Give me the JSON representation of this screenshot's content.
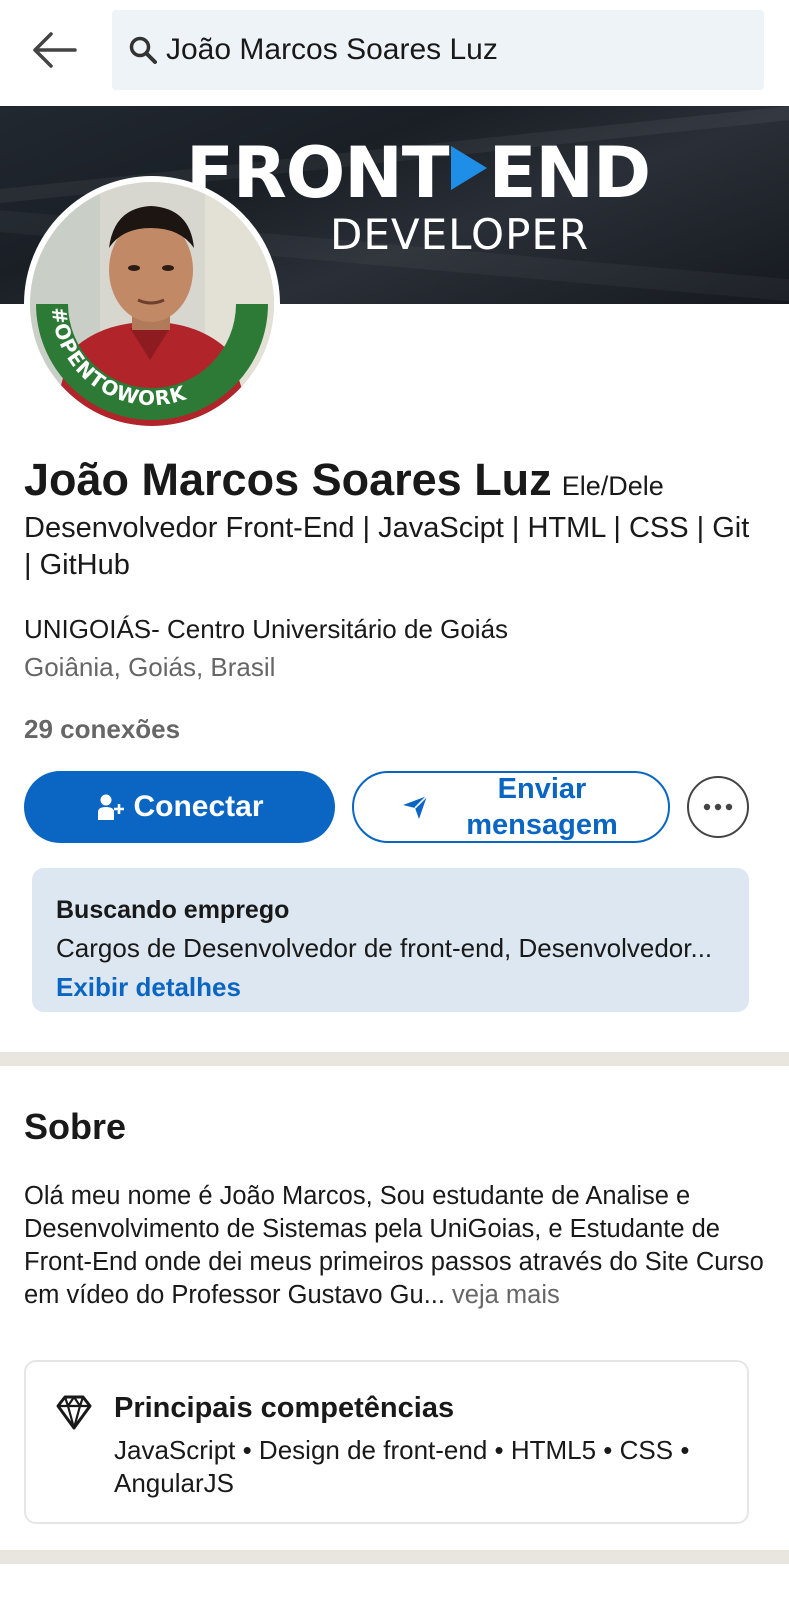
{
  "search": {
    "query": "João Marcos Soares Luz"
  },
  "banner": {
    "title_left": "FRONT",
    "title_right": "END",
    "subtitle": "DEVELOPER"
  },
  "avatar": {
    "badge": "#OPENTOWORK",
    "ring_color": "#2d7a37"
  },
  "profile": {
    "name": "João Marcos Soares Luz",
    "pronouns": "Ele/Dele",
    "headline": "Desenvolvedor  Front-End | JavaScipt | HTML | CSS | Git | GitHub",
    "school": "UNIGOIÁS- Centro Universitário de Goiás",
    "location": "Goiânia, Goiás, Brasil",
    "connections": "29 conexões"
  },
  "actions": {
    "connect_label": "Conectar",
    "message_label": "Enviar mensagem",
    "more_icon": "ellipsis-icon"
  },
  "open_to_work": {
    "title": "Buscando emprego",
    "description": "Cargos de Desenvolvedor de front-end, Desenvolvedor...",
    "link": "Exibir detalhes"
  },
  "about": {
    "title": "Sobre",
    "text": "Olá meu nome é João Marcos, Sou estudante de Analise e Desenvolvimento de Sistemas pela UniGoias, e Estudante de  Front-End onde dei meus primeiros passos através do Site Curso em vídeo do Professor Gustavo Gu...",
    "see_more": " veja mais"
  },
  "skills": {
    "title": "Principais competências",
    "list": "JavaScript • Design de front-end • HTML5 • CSS • AngularJS"
  },
  "colors": {
    "primary": "#0a66c2",
    "card_bg": "#dde7f1",
    "search_bg": "#eef3f8",
    "divider": "#e9e5df"
  }
}
